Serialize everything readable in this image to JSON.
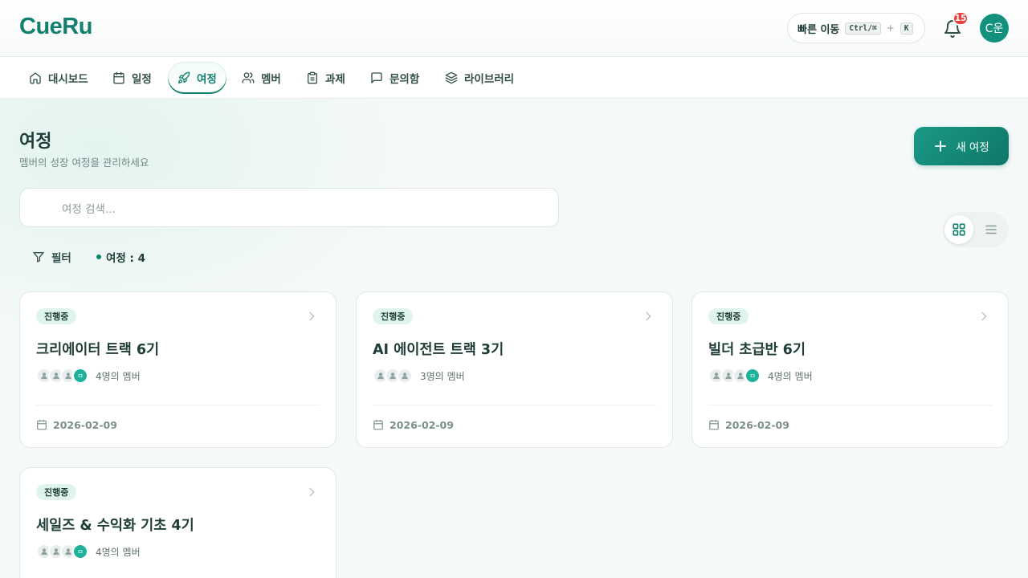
{
  "app": {
    "logo": "CueRu",
    "quick_nav": {
      "label": "빠른 이동",
      "key1": "Ctrl/⌘",
      "plus": "+",
      "key2": "K"
    },
    "notifications": {
      "icon": "bell-icon",
      "count": "15"
    },
    "user": {
      "initials": "C운"
    }
  },
  "nav": {
    "items": [
      {
        "label": "대시보드",
        "icon": "home-icon"
      },
      {
        "label": "일정",
        "icon": "calendar-icon"
      },
      {
        "label": "여정",
        "icon": "rocket-icon",
        "active": true
      },
      {
        "label": "멤버",
        "icon": "users-icon"
      },
      {
        "label": "과제",
        "icon": "clipboard-icon"
      },
      {
        "label": "문의함",
        "icon": "message-icon"
      },
      {
        "label": "라이브러리",
        "icon": "layers-icon"
      }
    ]
  },
  "page": {
    "title": "여정",
    "subtitle": "멤버의 성장 여정을 관리하세요",
    "new_button": "새 여정",
    "search_placeholder": "여정 검색...",
    "filter_label": "필터",
    "count_label": "여정 : 4"
  },
  "journeys": [
    {
      "status": "진행중",
      "title": "크리에이터 트랙 6기",
      "members": "4명의 멤버",
      "date": "2026-02-09",
      "initial": "ㅁ"
    },
    {
      "status": "진행중",
      "title": "AI 에이전트 트랙 3기",
      "members": "3명의 멤버",
      "date": "2026-02-09",
      "initial": ""
    },
    {
      "status": "진행중",
      "title": "빌더 초급반 6기",
      "members": "4명의 멤버",
      "date": "2026-02-09",
      "initial": "ㅁ"
    },
    {
      "status": "진행중",
      "title": "세일즈 & 수익화 기초 4기",
      "members": "4명의 멤버",
      "date": "",
      "initial": "ㅁ"
    }
  ],
  "colors": {
    "brand": "#13806f",
    "badge": "#e8413d",
    "status_bg": "#dff5ec"
  }
}
